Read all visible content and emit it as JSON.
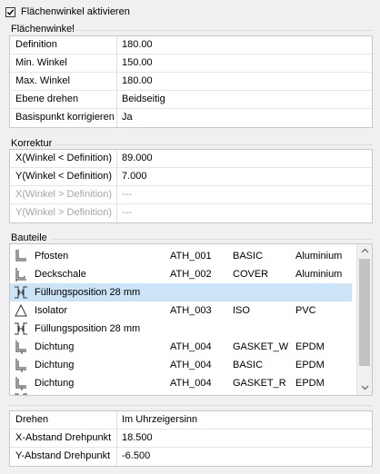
{
  "activate": {
    "label": "Flächenwinkel aktivieren",
    "checked": true
  },
  "flaechenwinkel": {
    "title": "Flächenwinkel",
    "rows": [
      {
        "key": "Definition",
        "value": "180.00"
      },
      {
        "key": "Min. Winkel",
        "value": "150.00"
      },
      {
        "key": "Max. Winkel",
        "value": "180.00"
      },
      {
        "key": "Ebene drehen",
        "value": "Beidseitig"
      },
      {
        "key": "Basispunkt korrigieren",
        "value": "Ja"
      }
    ]
  },
  "korrektur": {
    "title": "Korrektur",
    "rows": [
      {
        "key": "X(Winkel < Definition)",
        "value": "89.000",
        "disabled": false
      },
      {
        "key": "Y(Winkel < Definition)",
        "value": "7.000",
        "disabled": false
      },
      {
        "key": "X(Winkel > Definition)",
        "value": "---",
        "disabled": true
      },
      {
        "key": "Y(Winkel > Definition)",
        "value": "---",
        "disabled": true
      }
    ]
  },
  "bauteile": {
    "title": "Bauteile",
    "items": [
      {
        "icon": "post-profile-icon",
        "name": "Pfosten",
        "code": "ATH_001",
        "type": "BASIC",
        "material": "Aluminium",
        "selected": false
      },
      {
        "icon": "shell-profile-icon",
        "name": "Deckschale",
        "code": "ATH_002",
        "type": "COVER",
        "material": "Aluminium",
        "selected": false
      },
      {
        "icon": "infill-position-icon",
        "name": "Füllungsposition 28 mm",
        "code": "",
        "type": "",
        "material": "",
        "selected": true
      },
      {
        "icon": "isolator-triangle-icon",
        "name": "Isolator",
        "code": "ATH_003",
        "type": "ISO",
        "material": "PVC",
        "selected": false
      },
      {
        "icon": "infill-position-icon",
        "name": "Füllungsposition 28 mm",
        "code": "",
        "type": "",
        "material": "",
        "selected": false
      },
      {
        "icon": "gasket-profile-icon",
        "name": "Dichtung",
        "code": "ATH_004",
        "type": "GASKET_W",
        "material": "EPDM",
        "selected": false
      },
      {
        "icon": "gasket-profile-icon",
        "name": "Dichtung",
        "code": "ATH_004",
        "type": "BASIC",
        "material": "EPDM",
        "selected": false
      },
      {
        "icon": "gasket-profile-icon",
        "name": "Dichtung",
        "code": "ATH_004",
        "type": "GASKET_R",
        "material": "EPDM",
        "selected": false
      }
    ]
  },
  "drehen": {
    "rows": [
      {
        "key": "Drehen",
        "value": "Im Uhrzeigersinn"
      },
      {
        "key": "X-Abstand Drehpunkt",
        "value": "18.500"
      },
      {
        "key": "Y-Abstand Drehpunkt",
        "value": "-6.500"
      }
    ]
  }
}
